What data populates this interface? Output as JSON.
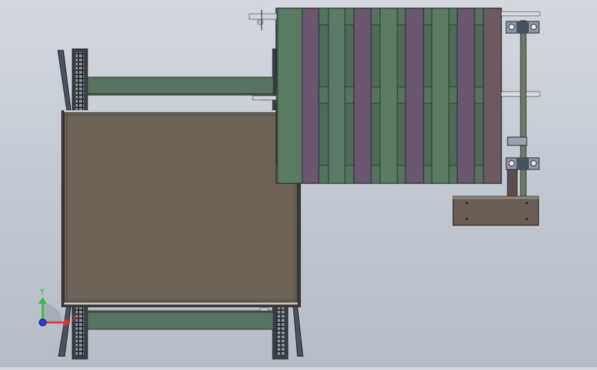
{
  "viewport": {
    "background_top": "#d3d8df",
    "background_bottom": "#b7bdc7",
    "triad": {
      "y_label": "Y",
      "x_label": "X",
      "y_color": "#2fbf3a",
      "x_color": "#d93a2a",
      "z_color": "#2a3fd9"
    }
  },
  "model": {
    "left_conveyor": {
      "frame_color": "#3f4650",
      "beam_color": "#57725f",
      "panel_color": "#6c6256",
      "edge_color": "#2a2d31"
    },
    "pallet": {
      "board_colors": [
        "#5a7a63",
        "#6a566e"
      ],
      "frame_color": "#4f6a58"
    },
    "motor_unit": {
      "shaft_color": "#6e7a68",
      "bearing_color": "#8b98a6",
      "base_color": "#6a5e54"
    }
  }
}
